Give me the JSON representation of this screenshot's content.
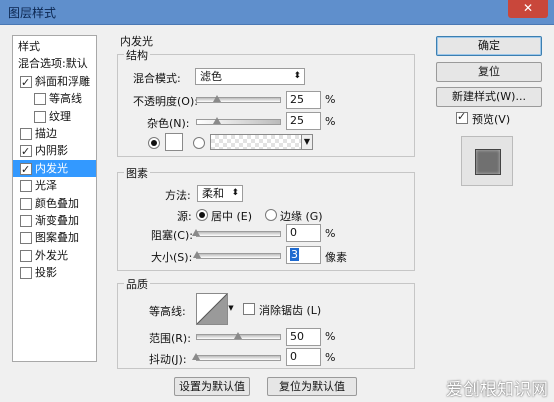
{
  "window": {
    "title": "图层样式",
    "close": "✕"
  },
  "sidebar": {
    "items": [
      {
        "label": "样式",
        "checkbox": false,
        "checked": false,
        "selected": false,
        "indent": 0
      },
      {
        "label": "混合选项:默认",
        "checkbox": false,
        "checked": false,
        "selected": false,
        "indent": 0
      },
      {
        "label": "斜面和浮雕",
        "checkbox": true,
        "checked": true,
        "selected": false,
        "indent": 0
      },
      {
        "label": "等高线",
        "checkbox": true,
        "checked": false,
        "selected": false,
        "indent": 1
      },
      {
        "label": "纹理",
        "checkbox": true,
        "checked": false,
        "selected": false,
        "indent": 1
      },
      {
        "label": "描边",
        "checkbox": true,
        "checked": false,
        "selected": false,
        "indent": 0
      },
      {
        "label": "内阴影",
        "checkbox": true,
        "checked": true,
        "selected": false,
        "indent": 0
      },
      {
        "label": "内发光",
        "checkbox": true,
        "checked": true,
        "selected": true,
        "indent": 0
      },
      {
        "label": "光泽",
        "checkbox": true,
        "checked": false,
        "selected": false,
        "indent": 0
      },
      {
        "label": "颜色叠加",
        "checkbox": true,
        "checked": false,
        "selected": false,
        "indent": 0
      },
      {
        "label": "渐变叠加",
        "checkbox": true,
        "checked": false,
        "selected": false,
        "indent": 0
      },
      {
        "label": "图案叠加",
        "checkbox": true,
        "checked": false,
        "selected": false,
        "indent": 0
      },
      {
        "label": "外发光",
        "checkbox": true,
        "checked": false,
        "selected": false,
        "indent": 0
      },
      {
        "label": "投影",
        "checkbox": true,
        "checked": false,
        "selected": false,
        "indent": 0
      }
    ]
  },
  "main": {
    "section_title": "内发光",
    "structure": {
      "title": "结构",
      "blend_label": "混合模式:",
      "blend_value": "滤色",
      "opacity_label": "不透明度(O):",
      "opacity_value": "25",
      "opacity_unit": "%",
      "opacity_level": 0.25,
      "noise_label": "杂色(N):",
      "noise_value": "25",
      "noise_unit": "%",
      "noise_level": 0.25
    },
    "elements": {
      "title": "图素",
      "method_label": "方法:",
      "method_value": "柔和",
      "source_label": "源:",
      "source_center": "居中 (E)",
      "source_edge": "边缘 (G)",
      "choke_label": "阻塞(C):",
      "choke_value": "0",
      "choke_unit": "%",
      "choke_level": 0,
      "size_label": "大小(S):",
      "size_value": "3",
      "size_unit": "像素",
      "size_level": 0.01
    },
    "quality": {
      "title": "品质",
      "contour_label": "等高线:",
      "antialias_label": "消除锯齿 (L)",
      "range_label": "范围(R):",
      "range_value": "50",
      "range_unit": "%",
      "range_level": 0.5,
      "jitter_label": "抖动(J):",
      "jitter_value": "0",
      "jitter_unit": "%",
      "jitter_level": 0
    },
    "buttons": {
      "set_default": "设置为默认值",
      "reset_default": "复位为默认值"
    }
  },
  "right": {
    "ok": "确定",
    "reset": "复位",
    "new_style": "新建样式(W)...",
    "preview_label": "预览(V)",
    "preview_checked": true
  },
  "watermark": "爱创根知识网"
}
